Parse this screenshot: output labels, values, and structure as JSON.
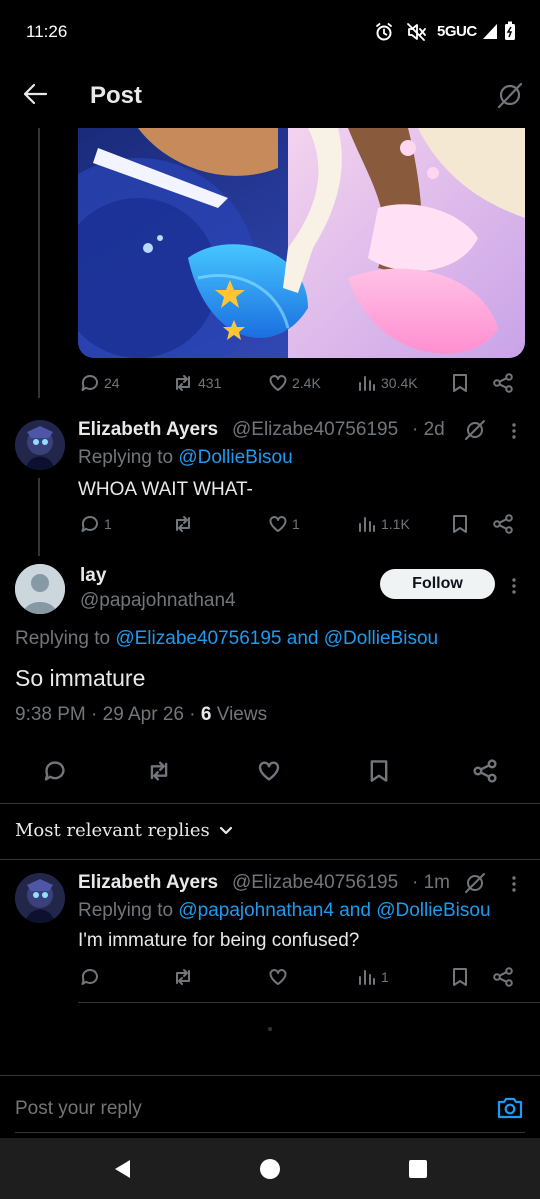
{
  "status_bar": {
    "time": "11:26",
    "network": "5GUC"
  },
  "header": {
    "title": "Post"
  },
  "prev_post": {
    "stats": {
      "replies": "24",
      "reposts": "431",
      "likes": "2.4K",
      "views": "30.4K"
    }
  },
  "reply1": {
    "name": "Elizabeth Ayers",
    "handle": "@Elizabe40756195",
    "time": "· 2d",
    "replying_prefix": "Replying to",
    "replying_to": "@DollieBisou",
    "text": "WHOA WAIT WHAT-",
    "stats": {
      "replies": "1",
      "reposts": "",
      "likes": "1",
      "views": "1.1K"
    }
  },
  "main_post": {
    "name": "lay",
    "handle": "@papajohnathan4",
    "follow_label": "Follow",
    "replying_prefix": "Replying to",
    "replying_to": "@Elizabe40756195 and @DollieBisou",
    "text": "So immature",
    "meta": "9:38 PM · 29 Apr 26 ·",
    "views_count": "6",
    "views_label": "Views"
  },
  "replies_sort": {
    "label": "Most relevant replies"
  },
  "reply2": {
    "name": "Elizabeth Ayers",
    "handle": "@Elizabe40756195",
    "time": "· 1m",
    "replying_prefix": "Replying to",
    "replying_to": "@papajohnathan4 and @DollieBisou",
    "text": "I'm immature for being confused?",
    "stats": {
      "views": "1"
    }
  },
  "composer": {
    "placeholder": "Post your reply"
  },
  "colors": {
    "accent": "#1d9bf0",
    "muted": "#71767b",
    "text": "#e7e9ea",
    "background": "#000000"
  }
}
